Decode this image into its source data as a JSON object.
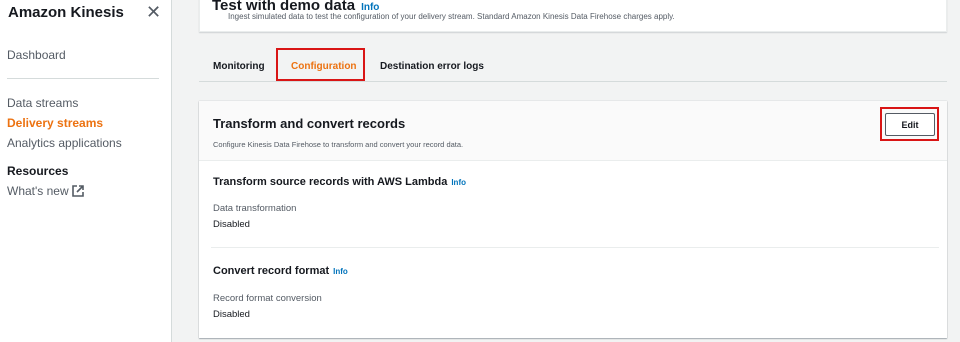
{
  "sidebar": {
    "title": "Amazon Kinesis",
    "close_icon": "close-icon",
    "dashboard": "Dashboard",
    "items": [
      {
        "label": "Data streams",
        "active": false
      },
      {
        "label": "Delivery streams",
        "active": true
      },
      {
        "label": "Analytics applications",
        "active": false
      }
    ],
    "resources_heading": "Resources",
    "whats_new": "What's new"
  },
  "top_panel": {
    "heading": "Test with demo data",
    "info": "Info",
    "description": "Ingest simulated data to test the configuration of your delivery stream. Standard Amazon Kinesis Data Firehose charges apply."
  },
  "tabs": [
    {
      "label": "Monitoring",
      "active": false
    },
    {
      "label": "Configuration",
      "active": true
    },
    {
      "label": "Destination error logs",
      "active": false
    }
  ],
  "card": {
    "title": "Transform and convert records",
    "description": "Configure Kinesis Data Firehose to transform and convert your record data.",
    "edit_label": "Edit",
    "lambda_section": {
      "title": "Transform source records with AWS Lambda",
      "info": "Info",
      "key": "Data transformation",
      "value": "Disabled"
    },
    "format_section": {
      "title": "Convert record format",
      "info": "Info",
      "key": "Record format conversion",
      "value": "Disabled"
    }
  },
  "colors": {
    "accent": "#ec7211",
    "link": "#0073bb",
    "highlight": "#d91515"
  }
}
